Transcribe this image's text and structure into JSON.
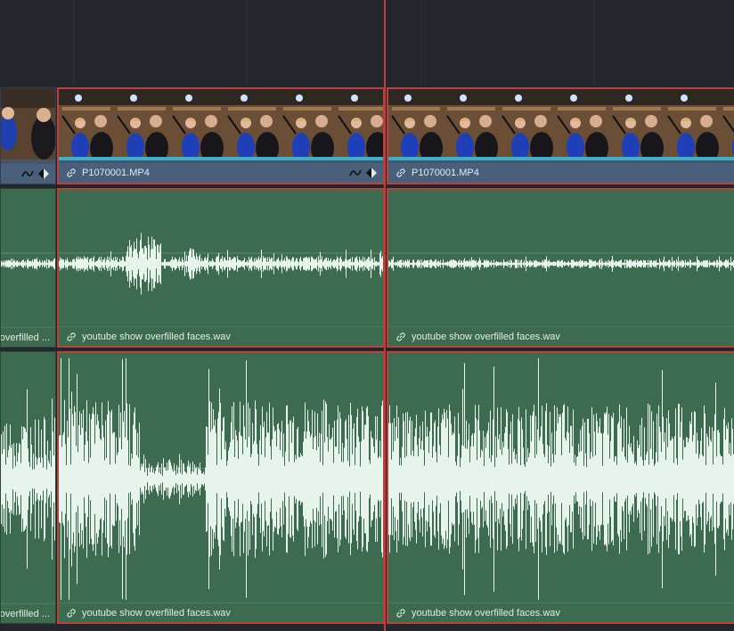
{
  "timeline": {
    "colors": {
      "background": "#25262b",
      "video_clip": "#44566d",
      "audio_clip": "#3c6b4f",
      "selection": "#b8433e",
      "playhead": "#c23b36",
      "waveform": "#e6f4ec"
    },
    "video_track": {
      "clips": [
        {
          "name": "",
          "selected": false,
          "icons": [
            "curve-icon",
            "keyframe-diamond-icon"
          ]
        },
        {
          "name": "P1070001.MP4",
          "selected": true,
          "icons": [
            "link-icon",
            "curve-icon",
            "keyframe-diamond-icon"
          ]
        },
        {
          "name": "P1070001.MP4",
          "selected": true,
          "icons": [
            "link-icon"
          ]
        }
      ]
    },
    "audio_track_1": {
      "clips": [
        {
          "name": "overfilled ...",
          "selected": false
        },
        {
          "name": "youtube show overfilled faces.wav",
          "selected": true,
          "icons": [
            "link-icon"
          ]
        },
        {
          "name": "youtube show overfilled faces.wav",
          "selected": true,
          "icons": [
            "link-icon"
          ]
        }
      ]
    },
    "audio_track_2": {
      "clips": [
        {
          "name": "overfilled ...",
          "selected": false
        },
        {
          "name": "youtube show overfilled faces.wav",
          "selected": true,
          "icons": [
            "link-icon"
          ]
        },
        {
          "name": "youtube show overfilled faces.wav",
          "selected": true,
          "icons": [
            "link-icon"
          ]
        }
      ]
    }
  }
}
